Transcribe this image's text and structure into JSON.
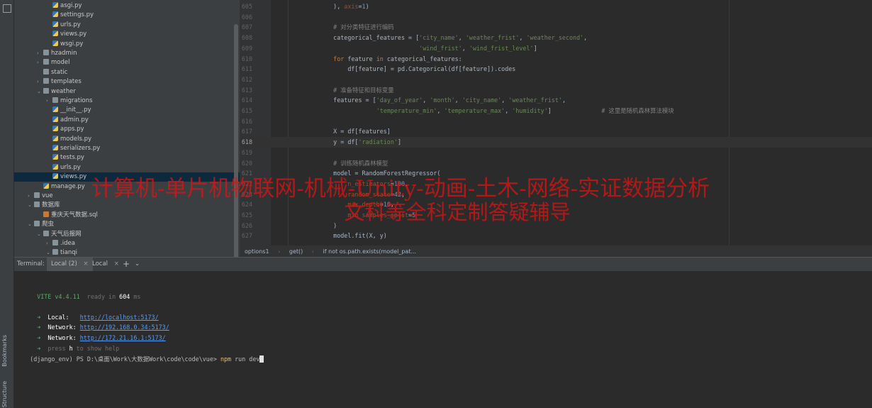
{
  "side_tabs": {
    "bookmarks": "Bookmarks",
    "structure": "Structure"
  },
  "project_tree": [
    {
      "label": "asgi.py",
      "type": "py",
      "indent": 3,
      "arrow": ""
    },
    {
      "label": "settings.py",
      "type": "py",
      "indent": 3,
      "arrow": ""
    },
    {
      "label": "urls.py",
      "type": "py",
      "indent": 3,
      "arrow": ""
    },
    {
      "label": "views.py",
      "type": "py",
      "indent": 3,
      "arrow": ""
    },
    {
      "label": "wsgi.py",
      "type": "py",
      "indent": 3,
      "arrow": ""
    },
    {
      "label": "hzadmin",
      "type": "folder",
      "indent": 2,
      "arrow": ">"
    },
    {
      "label": "model",
      "type": "folder",
      "indent": 2,
      "arrow": ">"
    },
    {
      "label": "static",
      "type": "folder",
      "indent": 2,
      "arrow": ""
    },
    {
      "label": "templates",
      "type": "folder",
      "indent": 2,
      "arrow": ">"
    },
    {
      "label": "weather",
      "type": "folder",
      "indent": 2,
      "arrow": "v"
    },
    {
      "label": "migrations",
      "type": "folder",
      "indent": 3,
      "arrow": ">"
    },
    {
      "label": "__init__.py",
      "type": "py",
      "indent": 3,
      "arrow": ""
    },
    {
      "label": "admin.py",
      "type": "py",
      "indent": 3,
      "arrow": ""
    },
    {
      "label": "apps.py",
      "type": "py",
      "indent": 3,
      "arrow": ""
    },
    {
      "label": "models.py",
      "type": "py",
      "indent": 3,
      "arrow": ""
    },
    {
      "label": "serializers.py",
      "type": "py",
      "indent": 3,
      "arrow": ""
    },
    {
      "label": "tests.py",
      "type": "py",
      "indent": 3,
      "arrow": ""
    },
    {
      "label": "urls.py",
      "type": "py",
      "indent": 3,
      "arrow": ""
    },
    {
      "label": "views.py",
      "type": "py",
      "indent": 3,
      "arrow": "",
      "selected": true
    },
    {
      "label": "manage.py",
      "type": "py",
      "indent": 2,
      "arrow": ""
    },
    {
      "label": "vue",
      "type": "folder",
      "indent": 1,
      "arrow": ">"
    },
    {
      "label": "数据库",
      "type": "folder",
      "indent": 1,
      "arrow": "v"
    },
    {
      "label": "重庆天气数据.sql",
      "type": "sql",
      "indent": 2,
      "arrow": ""
    },
    {
      "label": "爬虫",
      "type": "folder",
      "indent": 1,
      "arrow": "v"
    },
    {
      "label": "天气后报网",
      "type": "folder",
      "indent": 2,
      "arrow": "v"
    },
    {
      "label": ".idea",
      "type": "folder",
      "indent": 3,
      "arrow": ">"
    },
    {
      "label": "tianqi",
      "type": "folder",
      "indent": 3,
      "arrow": "v"
    }
  ],
  "code_lines": [
    {
      "n": "605",
      "html": "    ), <span class=\"param\">axis</span>=<span class=\"num\">1</span>)"
    },
    {
      "n": "606",
      "html": ""
    },
    {
      "n": "607",
      "html": "    <span class=\"cmt\"># 对分类特征进行编码</span>"
    },
    {
      "n": "608",
      "html": "    categorical_features = [<span class=\"str\">'city_name'</span>, <span class=\"str\">'weather_frist'</span>, <span class=\"str\">'weather_second'</span>,"
    },
    {
      "n": "609",
      "html": "                            <span class=\"str\">'wind_frist'</span>, <span class=\"str\">'wind_frist_level'</span>]"
    },
    {
      "n": "610",
      "html": "    <span class=\"kw\">for</span> feature <span class=\"kw\">in</span> categorical_features:"
    },
    {
      "n": "611",
      "html": "        df[feature] = pd.Categorical(df[feature]).codes"
    },
    {
      "n": "612",
      "html": ""
    },
    {
      "n": "613",
      "html": "    <span class=\"cmt\"># 准备特征和目标变量</span>"
    },
    {
      "n": "614",
      "html": "    features = [<span class=\"str\">'day_of_year'</span>, <span class=\"str\">'month'</span>, <span class=\"str\">'city_name'</span>, <span class=\"str\">'weather_frist'</span>,"
    },
    {
      "n": "615",
      "html": "                <span class=\"str\">'temperature_min'</span>, <span class=\"str\">'temperature_max'</span>, <span class=\"str\">'humidity'</span>]              <span class=\"cmt\"># 这里是随机森林算法模块</span>"
    },
    {
      "n": "616",
      "html": ""
    },
    {
      "n": "617",
      "html": "    X = df[features]"
    },
    {
      "n": "618",
      "html": "    y = df[<span class=\"str\">'radiation'</span>]",
      "current": true
    },
    {
      "n": "619",
      "html": ""
    },
    {
      "n": "620",
      "html": "    <span class=\"cmt\"># 训练随机森林模型</span>"
    },
    {
      "n": "621",
      "html": "    model = RandomForestRegressor("
    },
    {
      "n": "622",
      "html": "        <span class=\"param\">n_estimators</span>=<span class=\"num\">100</span>,"
    },
    {
      "n": "623",
      "html": "        <span class=\"param\">random_state</span>=<span class=\"num\">42</span>,"
    },
    {
      "n": "624",
      "html": "        <span class=\"param\">max_depth</span>=<span class=\"num\">10</span>,"
    },
    {
      "n": "625",
      "html": "        <span class=\"param\">min_samples_split</span>=<span class=\"num\">5</span>"
    },
    {
      "n": "626",
      "html": "    )"
    },
    {
      "n": "627",
      "html": "    model.fit(X, y)"
    }
  ],
  "breadcrumb": [
    "options1",
    "get()",
    "if not os.path.exists(model_pat..."
  ],
  "terminal_bar": {
    "label": "Terminal:",
    "tab1": "Local (2)",
    "tab1_close": "×",
    "tab2": "Local",
    "tab2_close": "×",
    "add": "+",
    "dropdown": "⌄"
  },
  "terminal": {
    "vite_name": "VITE",
    "vite_version": "v4.4.11",
    "ready_text": "ready in",
    "ready_ms": "604",
    "ms": "ms",
    "local_label": "Local:",
    "local_url": "http://localhost:5173/",
    "network_label": "Network:",
    "network_url1": "http://192.168.0.34:5173/",
    "network_url2": "http://172.21.16.1:5173/",
    "press": "press",
    "press_key": "h",
    "press_rest": "to show help",
    "prompt": "(django_env) PS D:\\桌面\\Work\\大数据Work\\code\\code\\vue>",
    "cmd": "npm",
    "cmd_rest": "run dev"
  },
  "watermark": {
    "line1": "计算机-单片机物联网-机械-Unity-动画-土木-网络-实证数据分析",
    "line2": "文科等全科定制答疑辅导"
  }
}
